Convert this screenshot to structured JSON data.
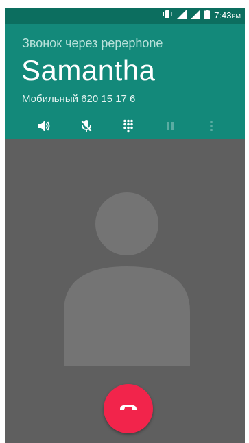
{
  "status_bar": {
    "time": "7:43",
    "ampm": "PM",
    "icons": [
      "vibrate-icon",
      "signal-icon",
      "signal-icon",
      "battery-icon"
    ]
  },
  "call": {
    "via": "Звонок через pepephone",
    "caller_name": "Samantha",
    "number_line": "Мобильный 620 15 17 6"
  },
  "controls": [
    {
      "name": "speaker",
      "icon": "speaker-icon",
      "enabled": true
    },
    {
      "name": "mute",
      "icon": "mute-icon",
      "enabled": true
    },
    {
      "name": "dialpad",
      "icon": "dialpad-icon",
      "enabled": true
    },
    {
      "name": "hold",
      "icon": "pause-icon",
      "enabled": false
    },
    {
      "name": "more",
      "icon": "more-vert-icon",
      "enabled": false
    }
  ],
  "colors": {
    "status_bar": "#0c6e5f",
    "header": "#13897a",
    "body": "#5f5f5f",
    "avatar": "#747474",
    "end_call": "#f2244b"
  },
  "end_call": {
    "icon": "end-call-icon"
  }
}
